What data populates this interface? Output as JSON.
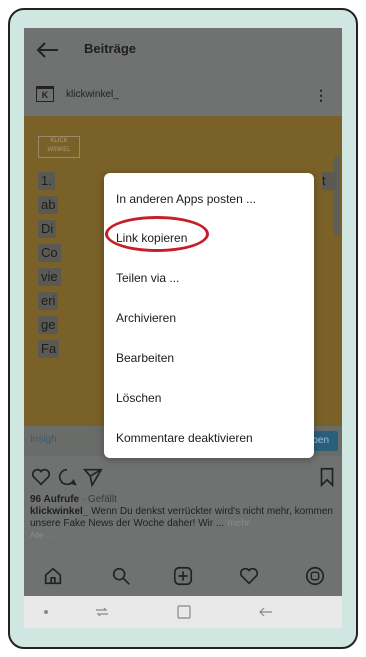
{
  "header": {
    "title": "Beiträge",
    "username": "klickwinkel_",
    "logo_text": "K"
  },
  "post": {
    "logo_text": "KLICK WINKEL",
    "lines": [
      "1.",
      "ab",
      "Di",
      "Co",
      "vie",
      "eri",
      "ge",
      "Fa"
    ],
    "right_chars": [
      "t",
      "",
      "",
      "",
      "",
      "",
      "",
      ""
    ]
  },
  "insights": {
    "left": "Insigh",
    "right": "rben"
  },
  "menu": {
    "items": [
      "In anderen Apps posten ...",
      "Link kopieren",
      "Teilen via ...",
      "Archivieren",
      "Bearbeiten",
      "Löschen",
      "Kommentare deaktivieren"
    ]
  },
  "meta": {
    "views": "96 Aufrufe",
    "liked": " · Gefällt",
    "caption_user": "klickwinkel_",
    "caption_text": " Wenn Du denkst verrückter wird's nicht mehr, kommen unsere Fake News der Woche daher! Wir ...",
    "more": "mehr",
    "extra": "Alle ..."
  },
  "icons": {
    "back": "back-arrow-icon",
    "like": "heart-icon",
    "comment": "comment-icon",
    "share": "send-icon",
    "save": "bookmark-icon",
    "home": "home-icon",
    "search": "search-icon",
    "add": "add-post-icon",
    "activity": "heart-icon",
    "profile": "profile-icon"
  }
}
